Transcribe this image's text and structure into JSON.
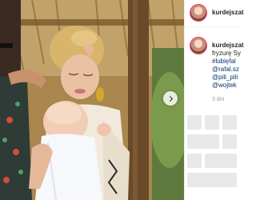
{
  "post": {
    "username": "kurdejszat",
    "caption_username": "kurdejszat",
    "caption_lines": [
      "fryzurę Sy",
      "#lubięfal",
      "@rafal.sz",
      "@pili_pili",
      "@wojtek"
    ],
    "time": "3 dni"
  },
  "icons": {
    "next": "chevron-right-icon",
    "avatar": "profile-picture-icon"
  },
  "colors": {
    "text": "#262626",
    "link": "#003569",
    "muted": "#999999",
    "story_ring": "#e3415e"
  }
}
